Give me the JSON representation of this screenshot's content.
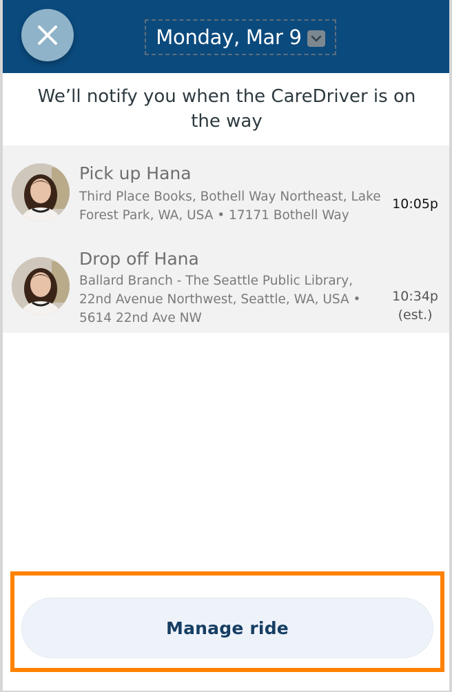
{
  "header": {
    "close_icon": "close-icon",
    "date": "Monday, Mar 9",
    "date_dropdown_icon": "chevron-down-icon",
    "colors": {
      "background": "#0b4a7d",
      "close_button": "#8fb3c8"
    }
  },
  "notice": "We’ll notify you when the CareDriver is on the way",
  "stops": [
    {
      "title": "Pick up Hana",
      "address": "Third Place Books, Bothell Way Northeast, Lake Forest Park, WA, USA • 17171 Bothell Way",
      "time": "10:05p",
      "time_note": ""
    },
    {
      "title": "Drop off Hana",
      "address": "Ballard Branch - The Seattle Public Library, 22nd Avenue Northwest, Seattle, WA, USA • 5614 22nd Ave NW",
      "time": "10:34p",
      "time_note": "(est.)"
    }
  ],
  "footer": {
    "manage_label": "Manage ride",
    "colors": {
      "highlight": "#ff8200",
      "button_bg": "#eef3fa",
      "button_text": "#163e63"
    }
  }
}
